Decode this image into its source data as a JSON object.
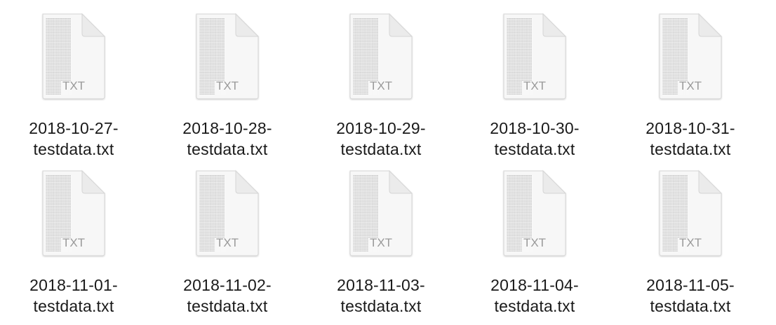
{
  "files": [
    {
      "name_line1": "2018-10-27-",
      "name_line2": "testdata.txt",
      "ext": "TXT"
    },
    {
      "name_line1": "2018-10-28-",
      "name_line2": "testdata.txt",
      "ext": "TXT"
    },
    {
      "name_line1": "2018-10-29-",
      "name_line2": "testdata.txt",
      "ext": "TXT"
    },
    {
      "name_line1": "2018-10-30-",
      "name_line2": "testdata.txt",
      "ext": "TXT"
    },
    {
      "name_line1": "2018-10-31-",
      "name_line2": "testdata.txt",
      "ext": "TXT"
    },
    {
      "name_line1": "2018-11-01-",
      "name_line2": "testdata.txt",
      "ext": "TXT"
    },
    {
      "name_line1": "2018-11-02-",
      "name_line2": "testdata.txt",
      "ext": "TXT"
    },
    {
      "name_line1": "2018-11-03-",
      "name_line2": "testdata.txt",
      "ext": "TXT"
    },
    {
      "name_line1": "2018-11-04-",
      "name_line2": "testdata.txt",
      "ext": "TXT"
    },
    {
      "name_line1": "2018-11-05-",
      "name_line2": "testdata.txt",
      "ext": "TXT"
    }
  ],
  "icon": {
    "name": "txt-document-icon",
    "page_color": "#f7f7f7",
    "border_color": "#d6d6d6",
    "fold_color": "#ebebeb",
    "text_lines_color": "#b8b8b8",
    "ext_color": "#9a9a9a"
  },
  "label_color": "#1a1a1a"
}
